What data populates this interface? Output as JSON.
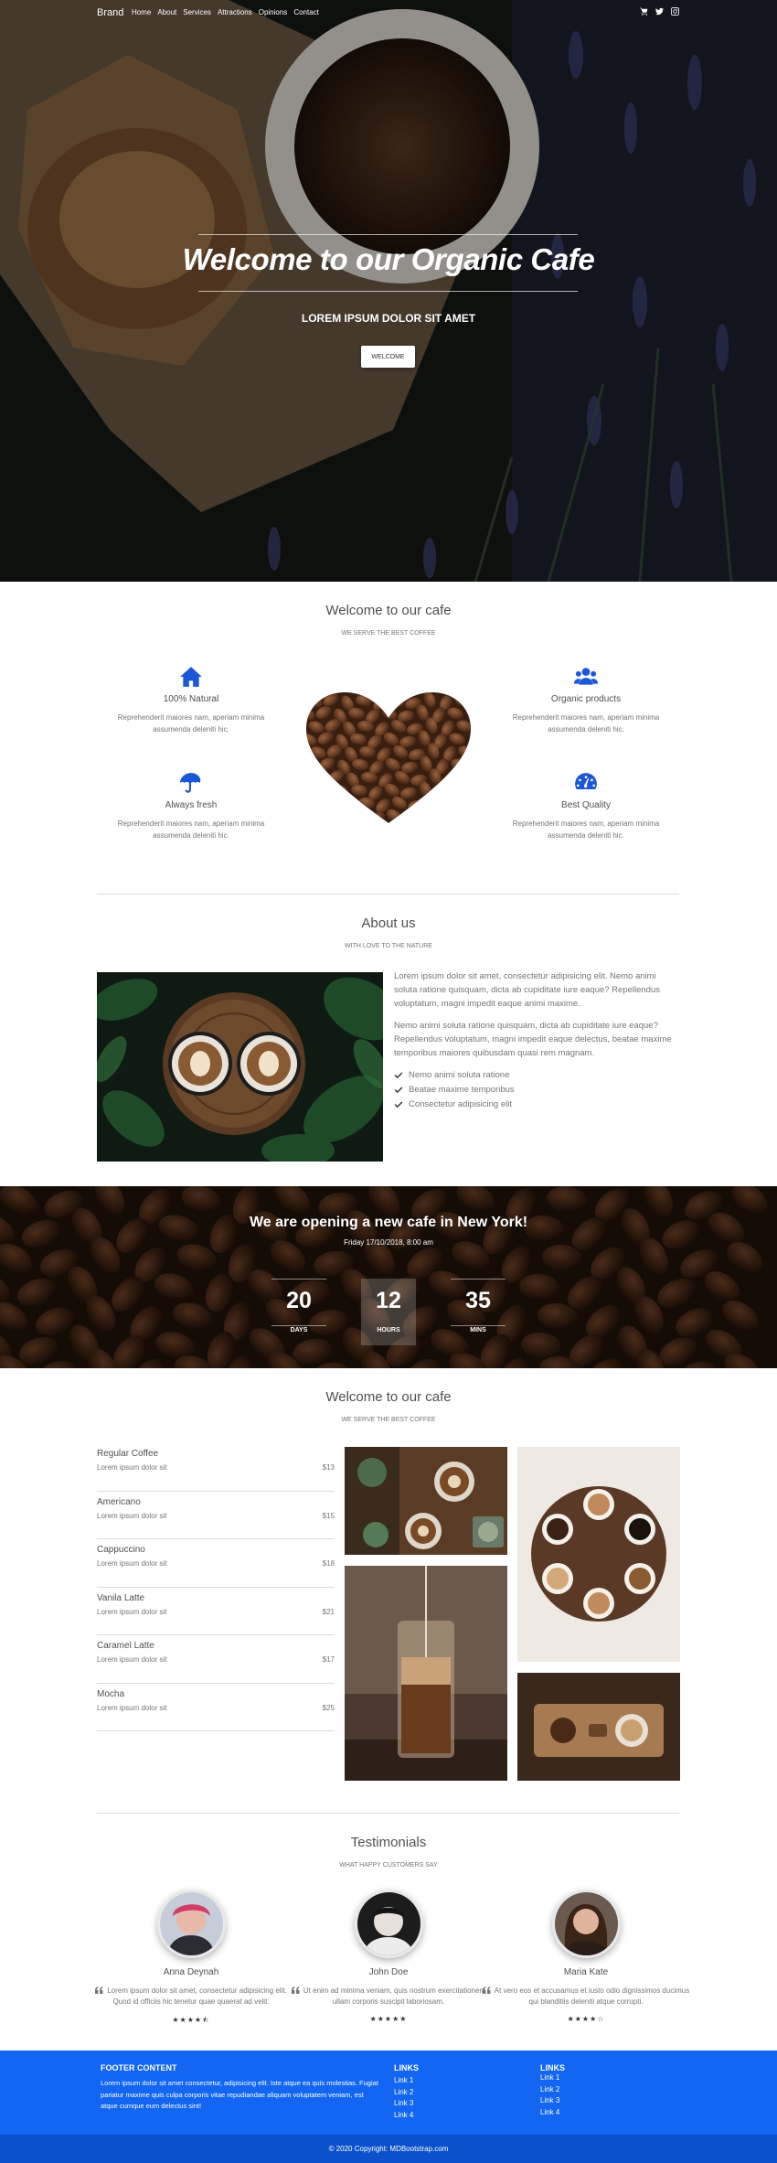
{
  "nav": {
    "brand": "Brand",
    "links": [
      "Home",
      "About",
      "Services",
      "Attractions",
      "Opinions",
      "Contact"
    ],
    "icons": [
      "cart-icon",
      "twitter-icon",
      "instagram-icon"
    ]
  },
  "hero": {
    "title": "Welcome to our Organic Cafe",
    "subtitle": "LOREM IPSUM DOLOR SIT AMET",
    "button": "WELCOME"
  },
  "welcome": {
    "title": "Welcome to our cafe",
    "subtitle": "WE SERVE THE BEST COFFEE",
    "features": [
      {
        "title": "100% Natural",
        "text": "Reprehenderit maiores nam, aperiam minima assumenda deleniti hic.",
        "icon": "home-icon"
      },
      {
        "title": "Organic products",
        "text": "Reprehenderit maiores nam, aperiam minima assumenda deleniti hic.",
        "icon": "users-icon"
      },
      {
        "title": "Always fresh",
        "text": "Reprehenderit maiores nam, aperiam minima assumenda deleniti hic.",
        "icon": "umbrella-icon"
      },
      {
        "title": "Best Quality",
        "text": "Reprehenderit maiores nam, aperiam minima assumenda deleniti hic.",
        "icon": "gauge-icon"
      }
    ]
  },
  "about": {
    "title": "About us",
    "subtitle": "WITH LOVE TO THE NATURE",
    "p1": "Lorem ipsum dolor sit amet, consectetur adipisicing elit. Nemo animi soluta ratione quisquam, dicta ab cupiditate iure eaque? Repellendus voluptatum, magni impedit eaque animi maxime.",
    "p2": "Nemo animi soluta ratione quisquam, dicta ab cupiditate iure eaque? Repellendus voluptatum, magni impedit eaque delectus, beatae maxime temporibus maiores quibusdam quasi rem magnam.",
    "list": [
      "Nemo animi soluta ratione",
      "Beatae maxime temporibus",
      "Consectetur adipisicing elit"
    ]
  },
  "opening": {
    "title": "We are opening a new cafe in New York!",
    "date": "Friday 17/10/2018, 8:00 am",
    "countdown": [
      {
        "value": "20",
        "label": "DAYS"
      },
      {
        "value": "12",
        "label": "HOURS"
      },
      {
        "value": "35",
        "label": "MINS"
      }
    ]
  },
  "menu": {
    "title": "Welcome to our cafe",
    "subtitle": "WE SERVE THE BEST COFFEE",
    "items": [
      {
        "name": "Regular Coffee",
        "desc": "Lorem ipsum dolor sit",
        "price": "$13"
      },
      {
        "name": "Americano",
        "desc": "Lorem ipsum dolor sit",
        "price": "$15"
      },
      {
        "name": "Cappuccino",
        "desc": "Lorem ipsum dolor sit",
        "price": "$18"
      },
      {
        "name": "Vanila Latte",
        "desc": "Lorem ipsum dolor sit",
        "price": "$21"
      },
      {
        "name": "Caramel Latte",
        "desc": "Lorem ipsum dolor sit",
        "price": "$17"
      },
      {
        "name": "Mocha",
        "desc": "Lorem ipsum dolor sit",
        "price": "$25"
      }
    ]
  },
  "testimonials": {
    "title": "Testimonials",
    "subtitle": "WHAT HAPPY CUSTOMERS SAY",
    "items": [
      {
        "name": "Anna Deynah",
        "quote": "Lorem ipsum dolor sit amet, consectetur adipisicing elit. Quod id officiis hic tenetur quae quaerat ad velit.",
        "stars": "★★★★⯪"
      },
      {
        "name": "John Doe",
        "quote": "Ut enim ad minima veniam, quis nostrum exercitationem ullam corporis suscipit laboriosam.",
        "stars": "★★★★★"
      },
      {
        "name": "Maria Kate",
        "quote": "At vero eos et accusamus et iusto odio dignissimos ducimus qui blanditiis deleniti atque corrupti.",
        "stars": "★★★★☆"
      }
    ]
  },
  "footer": {
    "content_title": "FOOTER CONTENT",
    "content_text": "Lorem ipsum dolor sit amet consectetur, adipisicing elit. Iste atque ea quis molestias. Fugiat pariatur maxime quis culpa corporis vitae repudiandae aliquam voluptatem veniam, est atque cumque eum delectus sint!",
    "links1_title": "LINKS",
    "links1": [
      "Link 1",
      "Link 2",
      "Link 3",
      "Link 4"
    ],
    "links2_title": "LINKS",
    "links2": [
      "Link 1",
      "Link 2",
      "Link 3",
      "Link 4"
    ],
    "copyright": "© 2020 Copyright: MDBootstrap.com"
  },
  "colors": {
    "accent": "#1266f1",
    "footer_bottom": "#0c51cc",
    "icon_blue": "#1c57d8"
  }
}
